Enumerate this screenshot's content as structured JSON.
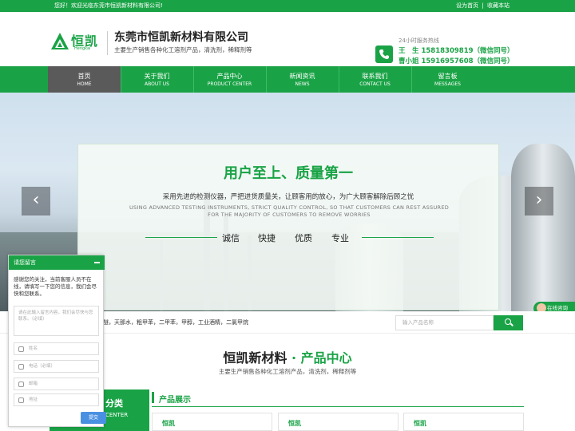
{
  "topbar": {
    "welcome": "您好！欢迎光临东莞市恒凯新材料有限公司!",
    "set_home": "设为首页",
    "separator": "|",
    "favorite": "收藏本站"
  },
  "header": {
    "logo_cn": "恒凯",
    "logo_en": "Hengkai",
    "company_name": "东莞市恒凯新材料有限公司",
    "company_desc": "主要生产销售各种化工溶剂产品，清洗剂，稀释剂等",
    "hotline_title": "24小时服务热线",
    "contacts": [
      "王　生 15818309819（微信同号）",
      "曹小姐 15916957608（微信同号）"
    ],
    "brand_color": "#1aa346"
  },
  "nav": [
    {
      "cn": "首页",
      "en": "HOME"
    },
    {
      "cn": "关于我们",
      "en": "ABOUT US"
    },
    {
      "cn": "产品中心",
      "en": "PRODUCT CENTER"
    },
    {
      "cn": "新闻资讯",
      "en": "NEWS"
    },
    {
      "cn": "联系我们",
      "en": "CONTACT US"
    },
    {
      "cn": "留言板",
      "en": "MESSAGES"
    }
  ],
  "banner": {
    "title": "用户至上、质量第一",
    "subtitle": "采用先进的检测仪器，严把进货质量关，让顾客用的放心，为广大顾客解除后顾之忧",
    "subtitle_en": "USING ADVANCED TESTING INSTRUMENTS, STRICT QUALITY CONTROL, SO THAT CUSTOMERS CAN REST ASSURED FOR THE MAJORITY OF CUSTOMERS TO REMOVE WORRIES",
    "keywords": [
      "诚信",
      "快捷",
      "优质",
      "专业"
    ],
    "prev": "‹",
    "next": "›",
    "chat_label": "在线咨询"
  },
  "search": {
    "hot_words": "醚，天那水，粗甲苯，二甲苯，甲醇，工业酒精，二氯甲烷",
    "placeholder": "输入产品名称"
  },
  "products": {
    "brand": "恒凯新材料",
    "dot": "·",
    "section": "产品中心",
    "subtitle": "主要生产销售各种化工溶剂产品，清洗剂，稀释剂等",
    "category_cn": "分类",
    "category_en": "CENTER",
    "showcase_title": "产品展示",
    "card_logo": "恒凯"
  },
  "message": {
    "title": "请您留言",
    "intro": "感谢您的关注，当前客服人员不在线，请填写一下您的信息，我们会尽快和您联系。",
    "content_placeholder": "请在此输入留言内容，我们会尽快与您联系。（必填）",
    "fields": [
      "姓名",
      "电话（必填）",
      "邮箱",
      "地址"
    ],
    "submit": "提交"
  }
}
